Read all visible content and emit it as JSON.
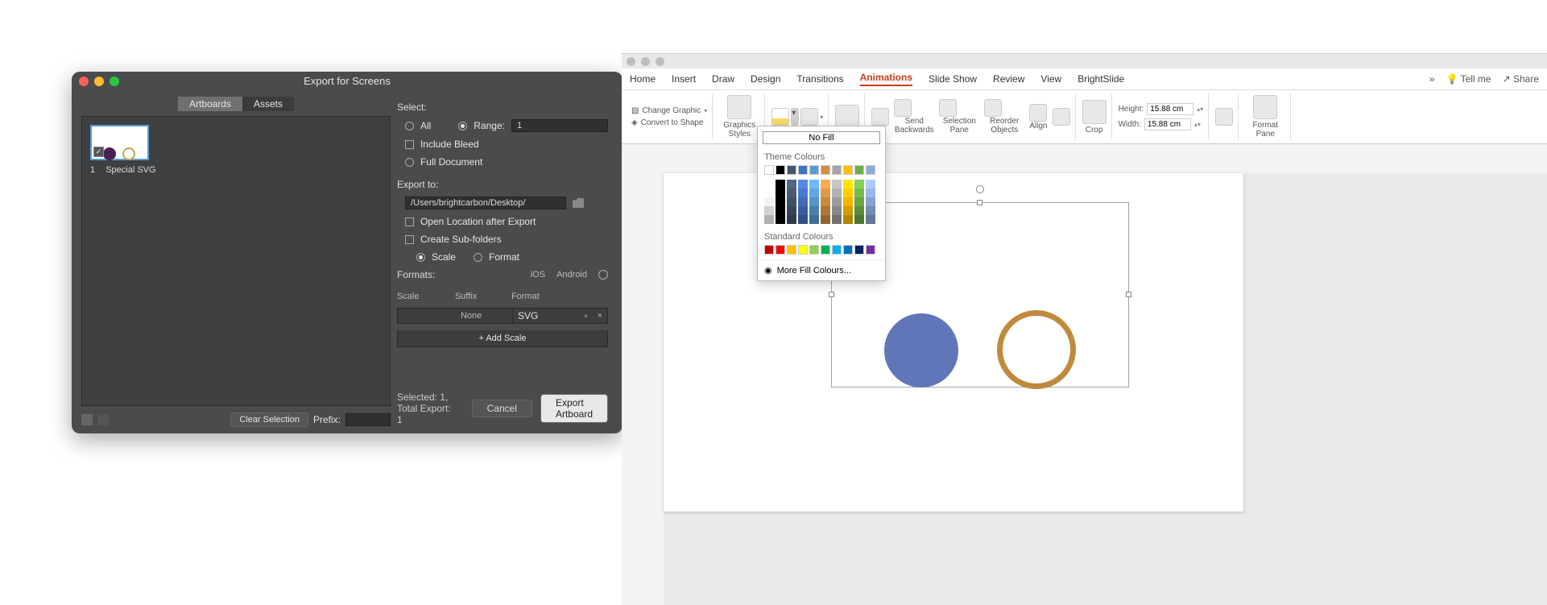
{
  "dialog": {
    "title": "Export for Screens",
    "tabs": {
      "artboards": "Artboards",
      "assets": "Assets"
    },
    "artboard": {
      "index": "1",
      "name": "Special SVG"
    },
    "clear": "Clear Selection",
    "prefix_label": "Prefix:",
    "select_label": "Select:",
    "all": "All",
    "range": "Range:",
    "range_value": "1",
    "include_bleed": "Include Bleed",
    "full_doc": "Full Document",
    "export_to": "Export to:",
    "path": "/Users/brightcarbon/Desktop/",
    "open_after": "Open Location after Export",
    "create_sub": "Create Sub-folders",
    "scale": "Scale",
    "format": "Format",
    "formats": "Formats:",
    "ios": "iOS",
    "android": "Android",
    "col_scale": "Scale",
    "col_suffix": "Suffix",
    "col_format": "Format",
    "row_suffix": "None",
    "row_format": "SVG",
    "add_scale": "+  Add Scale",
    "status": "Selected: 1, Total Export: 1",
    "cancel": "Cancel",
    "export": "Export Artboard"
  },
  "ppt": {
    "tabs": [
      "Home",
      "Insert",
      "Draw",
      "Design",
      "Transitions",
      "Animations",
      "Slide Show",
      "Review",
      "View",
      "BrightSlide"
    ],
    "active_tab": "Animations",
    "tell_me": "Tell me",
    "share": "Share",
    "change_graphic": "Change Graphic",
    "convert_shape": "Convert to Shape",
    "graphics_styles": "Graphics Styles",
    "send_backwards": "Send Backwards",
    "selection_pane": "Selection Pane",
    "reorder_objects": "Reorder Objects",
    "align": "Align",
    "crop": "Crop",
    "height": "Height:",
    "width": "Width:",
    "height_val": "15.88 cm",
    "width_val": "15.88 cm",
    "format_pane": "Format Pane",
    "flyout": {
      "no_fill": "No Fill",
      "theme": "Theme Colours",
      "standard": "Standard Colours",
      "more": "More Fill Colours..."
    },
    "theme_row": [
      "#ffffff",
      "#000000",
      "#44546a",
      "#4472c4",
      "#5b9bd5",
      "#d38f41",
      "#a5a5a5",
      "#ffc000",
      "#70ad47",
      "#8faadc"
    ],
    "standard_row": [
      "#c00000",
      "#ff0000",
      "#ffc000",
      "#ffff00",
      "#92d050",
      "#00b050",
      "#00b0f0",
      "#0070c0",
      "#002060",
      "#7030a0"
    ]
  }
}
